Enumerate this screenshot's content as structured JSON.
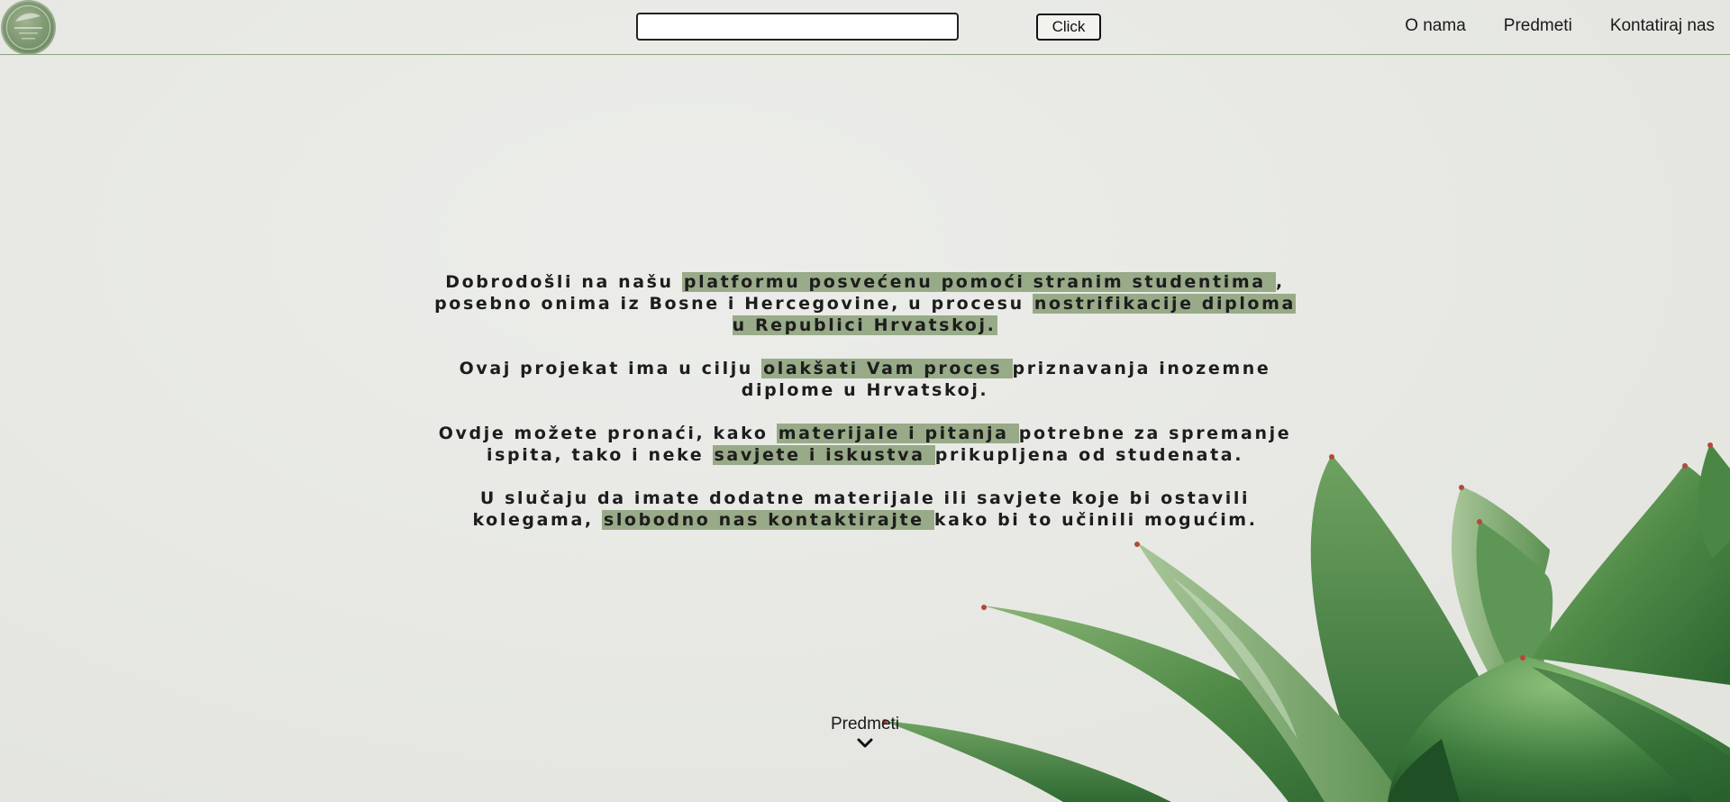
{
  "header": {
    "search": {
      "value": "",
      "placeholder": ""
    },
    "search_button_label": "Click",
    "nav": [
      {
        "label": "O nama"
      },
      {
        "label": "Predmeti"
      },
      {
        "label": "Kontatiraj nas"
      }
    ]
  },
  "intro": {
    "paragraphs": [
      [
        {
          "text": "Dobrodošli na našu ",
          "highlight": false
        },
        {
          "text": "platformu posvećenu pomoći stranim studentima ",
          "highlight": true
        },
        {
          "text": ", posebno onima iz Bosne i Hercegovine, u procesu ",
          "highlight": false
        },
        {
          "text": "nostrifikacije diploma u Republici Hrvatskoj.",
          "highlight": true
        }
      ],
      [
        {
          "text": "Ovaj projekat ima u cilju ",
          "highlight": false
        },
        {
          "text": "olakšati Vam proces ",
          "highlight": true
        },
        {
          "text": "priznavanja inozemne diplome u Hrvatskoj.",
          "highlight": false
        }
      ],
      [
        {
          "text": "Ovdje možete pronaći, kako ",
          "highlight": false
        },
        {
          "text": "materijale i pitanja ",
          "highlight": true
        },
        {
          "text": "potrebne za spremanje ispita, tako i neke ",
          "highlight": false
        },
        {
          "text": "savjete i iskustva ",
          "highlight": true
        },
        {
          "text": "prikupljena od studenata.",
          "highlight": false
        }
      ],
      [
        {
          "text": "U slučaju da imate dodatne materijale ili savjete koje bi ostavili kolegama, ",
          "highlight": false
        },
        {
          "text": "slobodno nas kontaktirajte ",
          "highlight": true
        },
        {
          "text": "kako bi to učinili mogućim.",
          "highlight": false
        }
      ]
    ]
  },
  "scroll_link": {
    "label": "Predmeti",
    "icon": "chevron-down-icon"
  },
  "colors": {
    "highlight": "#7f9470",
    "header_border": "#8fa083",
    "leaf_dark": "#2f6b33",
    "leaf_light": "#7fa86a"
  }
}
